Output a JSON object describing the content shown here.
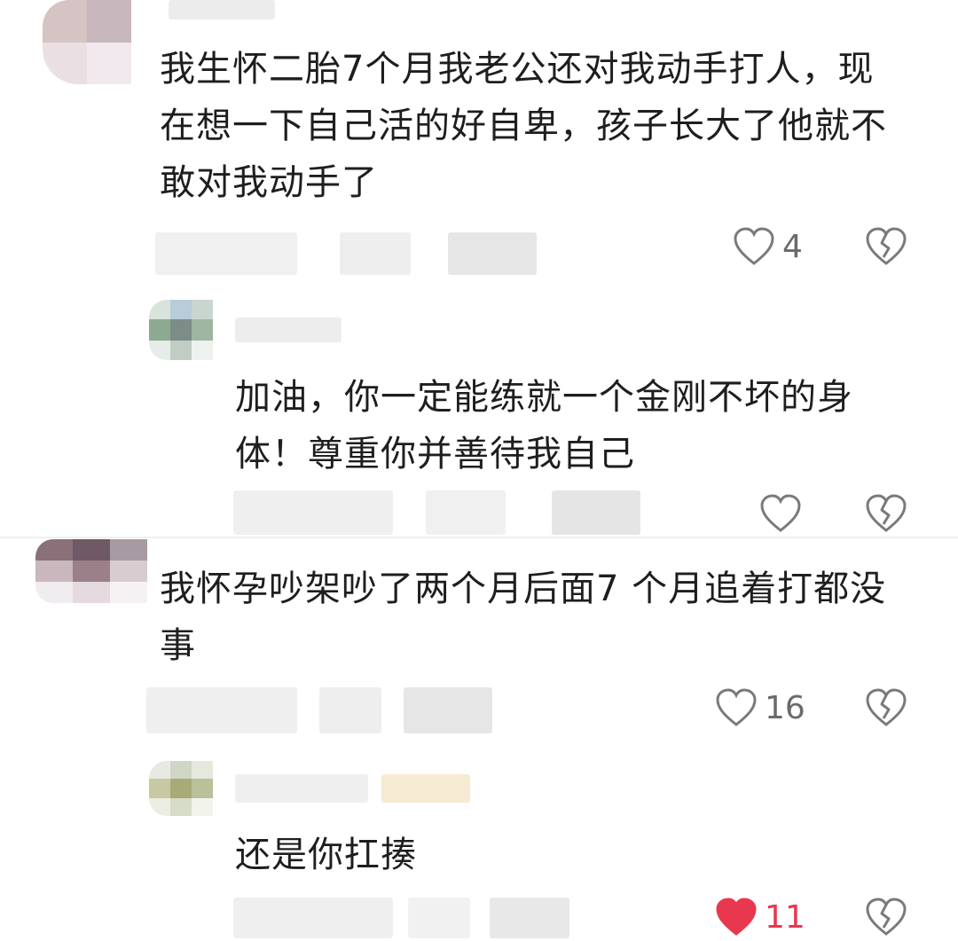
{
  "comments": [
    {
      "text": "我生怀二胎7个月我老公还对我动手打人，现在想一下自己活的好自卑，孩子长大了他就不敢对我动手了",
      "likes": "4",
      "liked": false,
      "reply": {
        "text": "加油，你一定能练就一个金刚不坏的身体！尊重你并善待我自己",
        "likes": "",
        "liked": false
      }
    },
    {
      "text": "我怀孕吵架吵了两个月后面7 个月追着打都没事",
      "likes": "16",
      "liked": false,
      "reply": {
        "text": "还是你扛揍",
        "likes": "11",
        "liked": true
      }
    }
  ],
  "icons": {
    "like": "heart-outline-icon",
    "liked": "heart-filled-icon",
    "dislike": "broken-heart-icon"
  },
  "colors": {
    "liked": "#e8384f",
    "icon": "#7a7a7a",
    "text": "#1e1e1e"
  }
}
